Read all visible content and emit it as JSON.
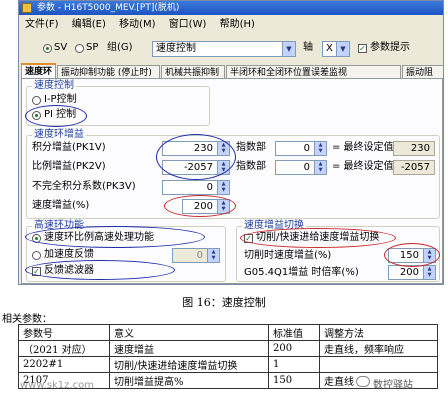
{
  "window": {
    "title": "参数 - H16T5000_MEV.[PT](脱机)",
    "menu": [
      "文件(F)",
      "编辑(E)",
      "移动(M)",
      "窗口(W)",
      "帮助(H)"
    ]
  },
  "toolbar": {
    "sv_label": "SV",
    "sp_label": "SP",
    "group_label": "组(G)",
    "group_value": "速度控制",
    "axis_label": "轴",
    "axis_value": "X",
    "hint_label": "参数提示"
  },
  "tabs": [
    "速度环",
    "振动抑制功能 (停止时)",
    "机械共振抑制",
    "半闭环和全闭环位置误差监视",
    "振动阻"
  ],
  "speed_control": {
    "title": "速度控制",
    "ip": "I-P控制",
    "pi": "PI 控制"
  },
  "speed_gain": {
    "title": "速度环增益",
    "rows": [
      {
        "label": "积分增益(PK1V)",
        "value": "230",
        "exp_label": "指数部",
        "exp_value": "0",
        "result_label": "= 最终设定值",
        "result_value": "230"
      },
      {
        "label": "比例增益(PK2V)",
        "value": "-2057",
        "exp_label": "指数部",
        "exp_value": "0",
        "result_label": "= 最终设定值",
        "result_value": "-2057"
      }
    ],
    "imperfect_label": "不完全积分系数(PK3V)",
    "imperfect_value": "0",
    "speed_gain_label": "速度增益(%)",
    "speed_gain_value": "200"
  },
  "high_speed": {
    "title": "高速环功能",
    "proportional": "速度环比例高速处理功能",
    "accel_fb": "加速度反馈",
    "accel_fb_value": "0",
    "feedback_filter": "反馈滤波器"
  },
  "gain_switch": {
    "title": "速度增益切换",
    "switch_label": "切削/快速进给速度增益切换",
    "cut_gain_label": "切削时速度增益(%)",
    "cut_gain_value": "150",
    "g05_label": "G05.4Q1增益 时倍率(%)",
    "g05_value": "200"
  },
  "caption": "图 16：速度控制",
  "params_title": "相关参数：",
  "table": {
    "headers": [
      "参数号",
      "意义",
      "标准值",
      "调整方法"
    ],
    "rows": [
      [
        "（2021 对应）",
        "速度增益",
        "200",
        "走直线，频率响应"
      ],
      [
        "2202#1",
        "切削/快速进给速度增益切换",
        "1",
        ""
      ],
      [
        "2107",
        "切削增益提高%",
        "150",
        "走直线"
      ]
    ]
  },
  "watermark": {
    "site": "www.sk1z.com",
    "brand": "数控驿站"
  },
  "colors": {
    "title_bar": "#1c54c4",
    "group_title": "#1f3f9f",
    "ellipse_blue": "#1d2aa8",
    "ellipse_red": "#c8282a",
    "active_tab": "#e68b2c"
  }
}
